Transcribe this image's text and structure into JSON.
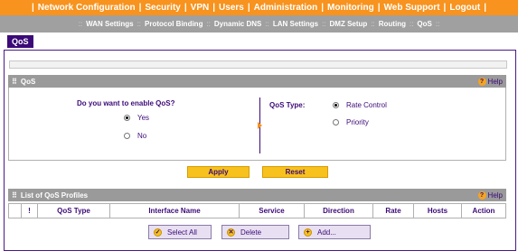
{
  "top_nav": {
    "items": [
      "Network Configuration",
      "Security",
      "VPN",
      "Users",
      "Administration",
      "Monitoring",
      "Web Support",
      "Logout"
    ]
  },
  "sub_nav": {
    "items": [
      "WAN Settings",
      "Protocol Binding",
      "Dynamic DNS",
      "LAN Settings",
      "DMZ Setup",
      "Routing",
      "QoS"
    ]
  },
  "page_tab": "QoS",
  "qos_section": {
    "title": "QoS",
    "help": "Help",
    "question": "Do you want to enable QoS?",
    "enable_options": [
      {
        "label": "Yes",
        "selected": true
      },
      {
        "label": "No",
        "selected": false
      }
    ],
    "type_label": "QoS Type:",
    "type_options": [
      {
        "label": "Rate Control",
        "selected": true
      },
      {
        "label": "Priority",
        "selected": false
      }
    ]
  },
  "actions": {
    "apply": "Apply",
    "reset": "Reset"
  },
  "profiles_section": {
    "title": "List of QoS Profiles",
    "help": "Help",
    "columns": [
      "!",
      "QoS Type",
      "Interface Name",
      "Service",
      "Direction",
      "Rate",
      "Hosts",
      "Action"
    ]
  },
  "profile_buttons": {
    "select_all": "Select All",
    "delete": "Delete",
    "add": "Add..."
  },
  "colors": {
    "accent_orange": "#f7931e",
    "nav_grey": "#a0a0a0",
    "brand_purple": "#3c0a78",
    "button_yellow": "#f7c21e"
  }
}
